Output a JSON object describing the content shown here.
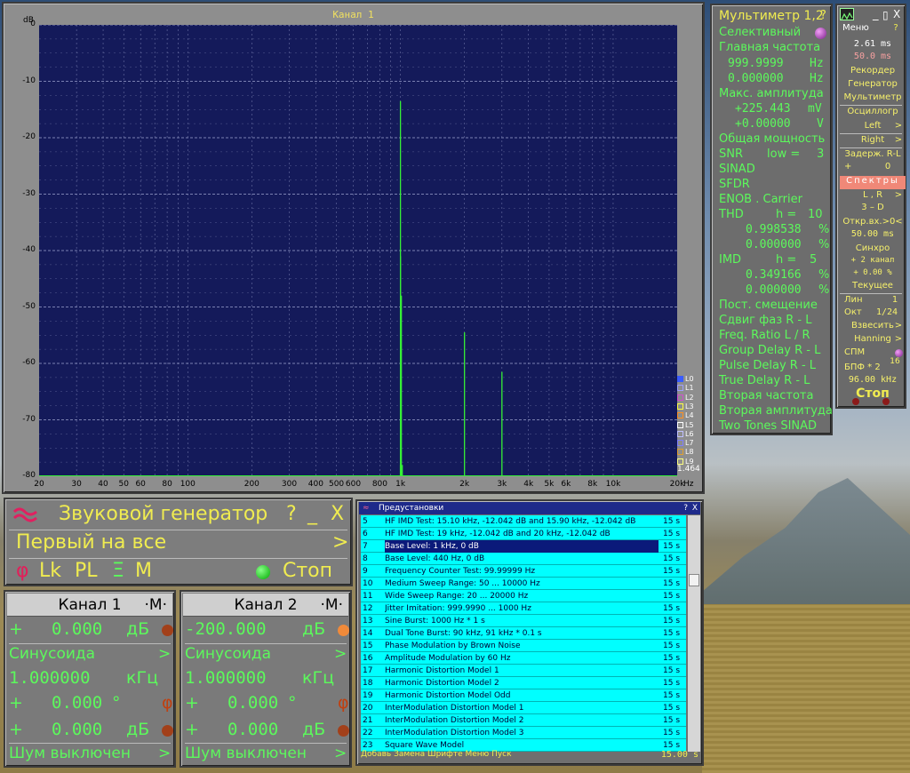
{
  "spectrum": {
    "title": "Канал 1",
    "yunit": "dB",
    "xunit": "Hz",
    "yticks": [
      "0",
      "-10",
      "-20",
      "-30",
      "-40",
      "-50",
      "-60",
      "-70",
      "-80"
    ],
    "xticks": [
      "20",
      "30",
      "40",
      "50",
      "60",
      "80",
      "100",
      "200",
      "300",
      "400",
      "500",
      "600",
      "800",
      "1k",
      "2k",
      "3k",
      "4k",
      "5k",
      "6k",
      "8k",
      "10k",
      "20k"
    ],
    "zoom": "1.464",
    "legend": [
      "L0",
      "L1",
      "L2",
      "L3",
      "L4",
      "L5",
      "L6",
      "L7",
      "L8",
      "L9"
    ],
    "colors": {
      "plot_bg": "#141a5a",
      "trace": "#36f036",
      "grid": "#7f86b6"
    }
  },
  "chart_data": {
    "type": "line",
    "title": "Канал 1",
    "ylabel": "dB",
    "xlabel": "Hz",
    "xscale": "log",
    "xlim": [
      20,
      20000
    ],
    "ylim": [
      -80,
      0
    ],
    "grid": true,
    "legend": "bottom-right",
    "series": [
      {
        "name": "L0",
        "x": [
          999.7,
          1000,
          1000.3,
          1010,
          1020,
          2000,
          3000
        ],
        "y": [
          -78,
          -13.5,
          -41,
          -48,
          -78,
          -54.5,
          -61.5
        ]
      }
    ]
  },
  "multimeter": {
    "title": "Мультиметр 1,2",
    "help": "?",
    "mode": "Селективный",
    "main_freq_label": "Главная частота",
    "freq1": "999.9999",
    "freq1_unit": "Hz",
    "freq2": "0.000000",
    "freq2_unit": "Hz",
    "max_amp_label": "Макс. амплитуда",
    "amp1": "+225.443",
    "amp1_unit": "mV",
    "amp2": "+0.00000",
    "amp2_unit": "V",
    "total_power": "Общая мощность",
    "snr": "SNR",
    "snr_low": "low =",
    "snr_low_val": "3",
    "sinad": "SINAD",
    "sfdr": "SFDR",
    "enob": "ENOB . Carrier",
    "thd": "THD",
    "thd_h": "h =",
    "thd_h_val": "10",
    "thd_v1": "0.998538",
    "thd_v2": "0.000000",
    "pct": "%",
    "imd": "IMD",
    "imd_h": "h =",
    "imd_h_val": "5",
    "imd_v1": "0.349166",
    "imd_v2": "0.000000",
    "dc_offset": "Пост. смещение",
    "phase_shift": "Сдвиг фаз R - L",
    "freq_ratio": "Freq. Ratio  L / R",
    "group_delay": "Group Delay R - L",
    "pulse_delay": "Pulse Delay R - L",
    "true_delay": "True Delay R - L",
    "second_freq": "Вторая частота",
    "second_amp": "Вторая амплитуда",
    "two_tones": "Two Tones SINAD"
  },
  "sidepanel": {
    "menu": "Меню",
    "help": "?",
    "min": "_",
    "max": "▯",
    "close": "X",
    "time1": "2.61 ms",
    "time2": "50.0 ms",
    "recorder": "Рекордер",
    "generator": "Генератор",
    "multimeter": "Мультиметр",
    "oscillograph": "Осциллогр",
    "left": "Left",
    "right": "Right",
    "arrow": ">",
    "delay": "Задерж. R-L",
    "delay_sign": "+",
    "delay_val": "0",
    "spectra": "Спектры",
    "lr": "L , R",
    "three_d": "3 – D",
    "open_in": "Откр.вх.>0<",
    "open_ms": "50.00 ms",
    "sync": "Синхро",
    "sync_val": "+ 2 канал",
    "sync_pct": "+ 0.00 %",
    "current": "Текущее",
    "lin": "Лин",
    "lin_val": "1",
    "oct": "Окт",
    "oct_val": "1/24",
    "weigh": "Взвесить",
    "hanning": "Hanning",
    "spm": "СПМ",
    "fft": "БПФ * 2",
    "fft_exp": "16",
    "rate": "96.00 kHz",
    "stop": "Стоп"
  },
  "generator": {
    "title": "Звуковой генератор",
    "help": "?",
    "min": "_",
    "close": "X",
    "mode": "Первый на все",
    "arrow": ">",
    "phi": "φ",
    "lk": "Lk",
    "pl": "PL",
    "sum": "Ξ",
    "m": "M",
    "stop": "Стоп"
  },
  "channels": [
    {
      "name": "Канал 1",
      "m": "·M·",
      "level_sign": "+",
      "level": "0.000",
      "level_unit": "дБ",
      "wave": "Синусоида",
      "freq": "1.000000",
      "freq_unit": "кГц",
      "phase_sign": "+",
      "phase": "0.000",
      "phase_unit": "°",
      "amp_sign": "+",
      "amp": "0.000",
      "amp_unit": "дБ",
      "noise": "Шум выключен"
    },
    {
      "name": "Канал 2",
      "m": "·M·",
      "level_sign": "",
      "level": "-200.000",
      "level_unit": "дБ",
      "wave": "Синусоида",
      "freq": "1.000000",
      "freq_unit": "кГц",
      "phase_sign": "+",
      "phase": "0.000",
      "phase_unit": "°",
      "amp_sign": "+",
      "amp": "0.000",
      "amp_unit": "дБ",
      "noise": "Шум выключен"
    }
  ],
  "presets": {
    "title": "Предустановки",
    "help": "?",
    "close": "X",
    "items": [
      {
        "n": "5",
        "text": "HF IMD Test: 15.10 kHz, -12.042 dB and 15.90 kHz, -12.042 dB",
        "dur": "15 s"
      },
      {
        "n": "6",
        "text": "HF IMD Test: 19 kHz,     -12.042 dB and 20 kHz,     -12.042 dB",
        "dur": "15 s"
      },
      {
        "n": "7",
        "text": "Base Level: 1 kHz,  0 dB",
        "dur": "15 s"
      },
      {
        "n": "8",
        "text": "Base Level: 440 Hz, 0 dB",
        "dur": "15 s"
      },
      {
        "n": "9",
        "text": "Frequency Counter Test: 99.99999 Hz",
        "dur": "15 s"
      },
      {
        "n": "10",
        "text": "Medium Sweep Range: 50 ... 10000 Hz",
        "dur": "15 s"
      },
      {
        "n": "11",
        "text": "Wide Sweep Range: 20 ... 20000 Hz",
        "dur": "15 s"
      },
      {
        "n": "12",
        "text": "Jitter Imitation: 999.9990 ... 1000 Hz",
        "dur": "15 s"
      },
      {
        "n": "13",
        "text": "Sine Burst: 1000 Hz * 1 s",
        "dur": "15 s"
      },
      {
        "n": "14",
        "text": "Dual Tone Burst: 90 kHz, 91 kHz * 0.1 s",
        "dur": "15 s"
      },
      {
        "n": "15",
        "text": "Phase Modulation by Brown Noise",
        "dur": "15 s"
      },
      {
        "n": "16",
        "text": "Amplitude Modulation by 60 Hz",
        "dur": "15 s"
      },
      {
        "n": "17",
        "text": "Harmonic Distortion Model 1",
        "dur": "15 s"
      },
      {
        "n": "18",
        "text": "Harmonic Distortion Model 2",
        "dur": "15 s"
      },
      {
        "n": "19",
        "text": "Harmonic Distortion Model Odd",
        "dur": "15 s"
      },
      {
        "n": "20",
        "text": "InterModulation Distortion Model 1",
        "dur": "15 s"
      },
      {
        "n": "21",
        "text": "InterModulation Distortion Model 2",
        "dur": "15 s"
      },
      {
        "n": "22",
        "text": "InterModulation Distortion Model 3",
        "dur": "15 s"
      },
      {
        "n": "23",
        "text": "Square Wave Model",
        "dur": "15 s"
      }
    ],
    "selected": "7",
    "footer": "Добавь Замена Шрифте Меню Пуск",
    "footer_time": "15.00 s"
  }
}
